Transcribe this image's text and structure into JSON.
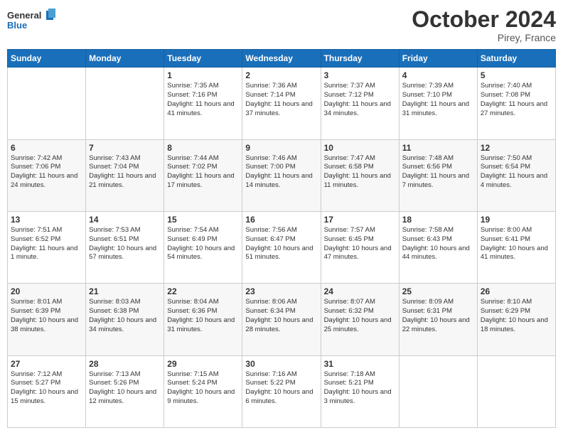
{
  "header": {
    "logo_general": "General",
    "logo_blue": "Blue",
    "month_title": "October 2024",
    "location": "Pirey, France"
  },
  "days_of_week": [
    "Sunday",
    "Monday",
    "Tuesday",
    "Wednesday",
    "Thursday",
    "Friday",
    "Saturday"
  ],
  "weeks": [
    [
      {
        "day": "",
        "info": ""
      },
      {
        "day": "",
        "info": ""
      },
      {
        "day": "1",
        "info": "Sunrise: 7:35 AM\nSunset: 7:16 PM\nDaylight: 11 hours and 41 minutes."
      },
      {
        "day": "2",
        "info": "Sunrise: 7:36 AM\nSunset: 7:14 PM\nDaylight: 11 hours and 37 minutes."
      },
      {
        "day": "3",
        "info": "Sunrise: 7:37 AM\nSunset: 7:12 PM\nDaylight: 11 hours and 34 minutes."
      },
      {
        "day": "4",
        "info": "Sunrise: 7:39 AM\nSunset: 7:10 PM\nDaylight: 11 hours and 31 minutes."
      },
      {
        "day": "5",
        "info": "Sunrise: 7:40 AM\nSunset: 7:08 PM\nDaylight: 11 hours and 27 minutes."
      }
    ],
    [
      {
        "day": "6",
        "info": "Sunrise: 7:42 AM\nSunset: 7:06 PM\nDaylight: 11 hours and 24 minutes."
      },
      {
        "day": "7",
        "info": "Sunrise: 7:43 AM\nSunset: 7:04 PM\nDaylight: 11 hours and 21 minutes."
      },
      {
        "day": "8",
        "info": "Sunrise: 7:44 AM\nSunset: 7:02 PM\nDaylight: 11 hours and 17 minutes."
      },
      {
        "day": "9",
        "info": "Sunrise: 7:46 AM\nSunset: 7:00 PM\nDaylight: 11 hours and 14 minutes."
      },
      {
        "day": "10",
        "info": "Sunrise: 7:47 AM\nSunset: 6:58 PM\nDaylight: 11 hours and 11 minutes."
      },
      {
        "day": "11",
        "info": "Sunrise: 7:48 AM\nSunset: 6:56 PM\nDaylight: 11 hours and 7 minutes."
      },
      {
        "day": "12",
        "info": "Sunrise: 7:50 AM\nSunset: 6:54 PM\nDaylight: 11 hours and 4 minutes."
      }
    ],
    [
      {
        "day": "13",
        "info": "Sunrise: 7:51 AM\nSunset: 6:52 PM\nDaylight: 11 hours and 1 minute."
      },
      {
        "day": "14",
        "info": "Sunrise: 7:53 AM\nSunset: 6:51 PM\nDaylight: 10 hours and 57 minutes."
      },
      {
        "day": "15",
        "info": "Sunrise: 7:54 AM\nSunset: 6:49 PM\nDaylight: 10 hours and 54 minutes."
      },
      {
        "day": "16",
        "info": "Sunrise: 7:56 AM\nSunset: 6:47 PM\nDaylight: 10 hours and 51 minutes."
      },
      {
        "day": "17",
        "info": "Sunrise: 7:57 AM\nSunset: 6:45 PM\nDaylight: 10 hours and 47 minutes."
      },
      {
        "day": "18",
        "info": "Sunrise: 7:58 AM\nSunset: 6:43 PM\nDaylight: 10 hours and 44 minutes."
      },
      {
        "day": "19",
        "info": "Sunrise: 8:00 AM\nSunset: 6:41 PM\nDaylight: 10 hours and 41 minutes."
      }
    ],
    [
      {
        "day": "20",
        "info": "Sunrise: 8:01 AM\nSunset: 6:39 PM\nDaylight: 10 hours and 38 minutes."
      },
      {
        "day": "21",
        "info": "Sunrise: 8:03 AM\nSunset: 6:38 PM\nDaylight: 10 hours and 34 minutes."
      },
      {
        "day": "22",
        "info": "Sunrise: 8:04 AM\nSunset: 6:36 PM\nDaylight: 10 hours and 31 minutes."
      },
      {
        "day": "23",
        "info": "Sunrise: 8:06 AM\nSunset: 6:34 PM\nDaylight: 10 hours and 28 minutes."
      },
      {
        "day": "24",
        "info": "Sunrise: 8:07 AM\nSunset: 6:32 PM\nDaylight: 10 hours and 25 minutes."
      },
      {
        "day": "25",
        "info": "Sunrise: 8:09 AM\nSunset: 6:31 PM\nDaylight: 10 hours and 22 minutes."
      },
      {
        "day": "26",
        "info": "Sunrise: 8:10 AM\nSunset: 6:29 PM\nDaylight: 10 hours and 18 minutes."
      }
    ],
    [
      {
        "day": "27",
        "info": "Sunrise: 7:12 AM\nSunset: 5:27 PM\nDaylight: 10 hours and 15 minutes."
      },
      {
        "day": "28",
        "info": "Sunrise: 7:13 AM\nSunset: 5:26 PM\nDaylight: 10 hours and 12 minutes."
      },
      {
        "day": "29",
        "info": "Sunrise: 7:15 AM\nSunset: 5:24 PM\nDaylight: 10 hours and 9 minutes."
      },
      {
        "day": "30",
        "info": "Sunrise: 7:16 AM\nSunset: 5:22 PM\nDaylight: 10 hours and 6 minutes."
      },
      {
        "day": "31",
        "info": "Sunrise: 7:18 AM\nSunset: 5:21 PM\nDaylight: 10 hours and 3 minutes."
      },
      {
        "day": "",
        "info": ""
      },
      {
        "day": "",
        "info": ""
      }
    ]
  ]
}
